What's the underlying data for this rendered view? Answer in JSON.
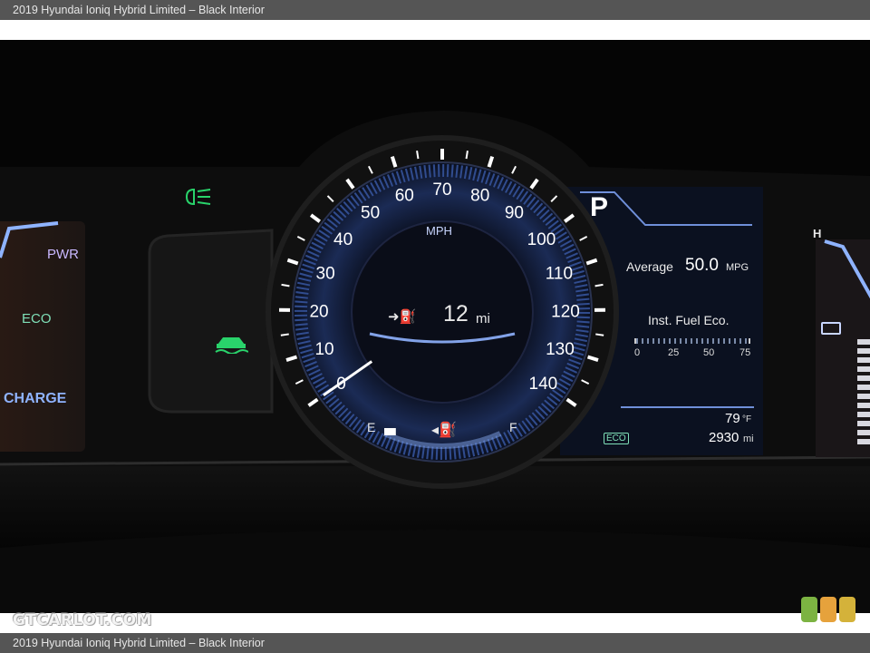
{
  "caption": "2019 Hyundai Ioniq Hybrid Limited – Black Interior",
  "watermark": "GTCARLOT.COM",
  "brand_square_colors": [
    "#7cb342",
    "#e6a23c",
    "#d4b23a"
  ],
  "cluster": {
    "power_gauge": {
      "pwr": "PWR",
      "eco": "ECO",
      "charge": "CHARGE"
    },
    "indicators": [
      "headlight-icon",
      "traction-control-icon"
    ],
    "speedometer": {
      "unit": "MPH",
      "tick_labels": [
        "0",
        "10",
        "20",
        "30",
        "40",
        "50",
        "60",
        "70",
        "80",
        "90",
        "100",
        "110",
        "120",
        "130",
        "140"
      ],
      "speed": 0,
      "range_value": "12",
      "range_unit": "mi",
      "fuel_empty": "E",
      "fuel_full": "F",
      "fuel_level_fraction": 0.1
    },
    "info_panel": {
      "gear": "P",
      "average_label": "Average",
      "average_value": "50.0",
      "average_unit": "MPG",
      "inst_label": "Inst. Fuel Eco.",
      "inst_scale": [
        "0",
        "25",
        "50",
        "75"
      ],
      "eco_badge": "ECO",
      "temperature": "79",
      "temperature_unit": "°F",
      "odometer": "2930",
      "odometer_unit": "mi"
    },
    "temp_gauge": {
      "hot": "H"
    }
  }
}
